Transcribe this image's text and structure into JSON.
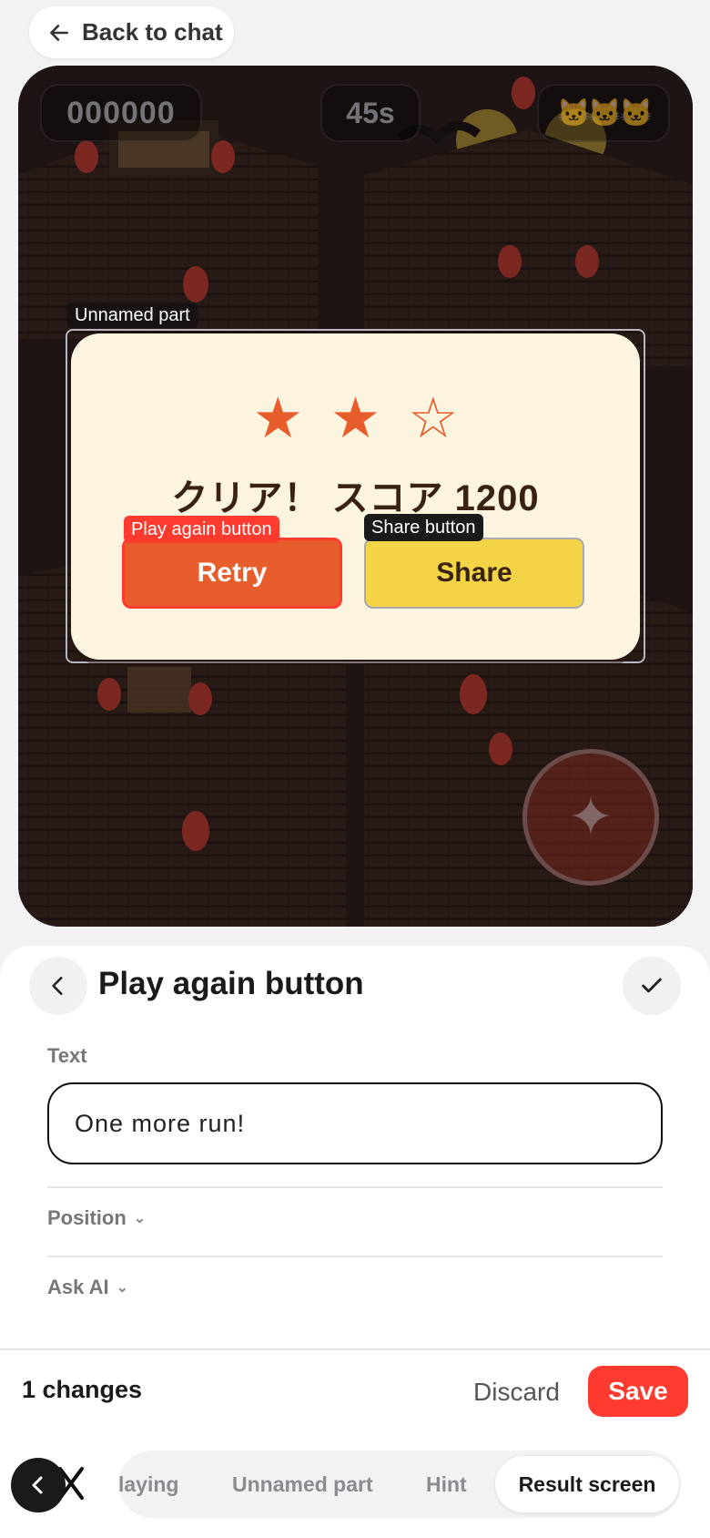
{
  "header": {
    "back_label": "Back to chat"
  },
  "game": {
    "score": "000000",
    "timer": "45s",
    "lives": "🐱🐱🐱",
    "stars": [
      "★",
      "★",
      "☆"
    ],
    "result_text": "クリア！ スコア 1200",
    "retry_label": "Retry",
    "share_label": "Share",
    "action_icon": "✦",
    "tags": {
      "unnamed_part": "Unnamed part",
      "play_again": "Play again button",
      "share": "Share button"
    }
  },
  "editor": {
    "title": "Play again button",
    "text_label": "Text",
    "text_value": "One more run!",
    "position_label": "Position",
    "ask_ai_label": "Ask AI"
  },
  "savebar": {
    "changes": "1 changes",
    "discard": "Discard",
    "save": "Save"
  },
  "tabs": {
    "items": [
      "laying",
      "Unnamed part",
      "Hint"
    ],
    "active": "Result screen"
  },
  "colors": {
    "accent_red": "#ff3b30",
    "retry_orange": "#e85d2c",
    "share_yellow": "#f4d447",
    "card_cream": "#fdf4e0"
  }
}
